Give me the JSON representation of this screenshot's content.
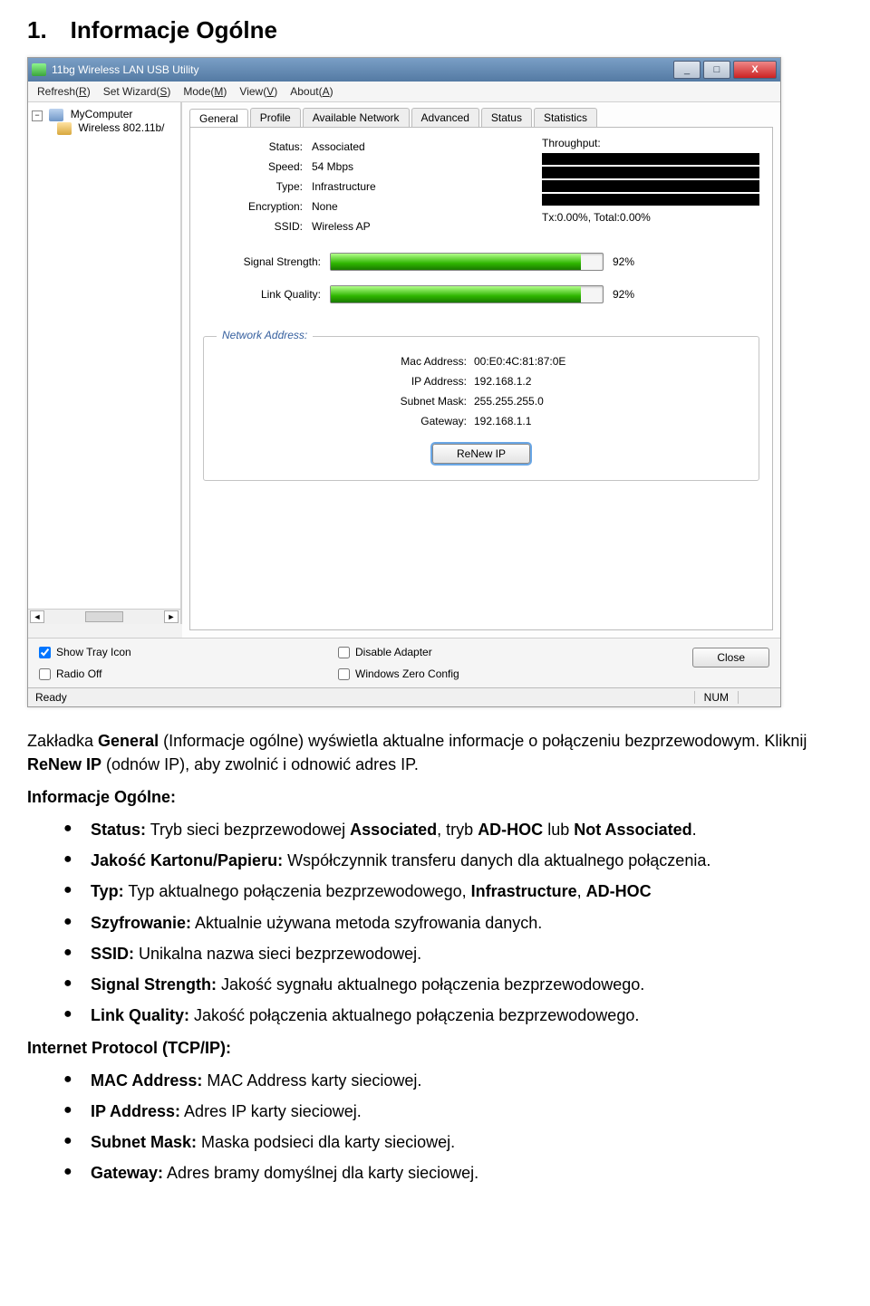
{
  "doc": {
    "heading": "1. Informacje Ogólne",
    "p_intro_1": "Zakładka ",
    "p_intro_b1": "General",
    "p_intro_2": " (Informacje ogólne) wyświetla aktualne informacje o połączeniu bezprzewodowym. Kliknij ",
    "p_intro_b2": "ReNew IP",
    "p_intro_3": " (odnów IP), aby zwolnić i odnowić adres IP.",
    "hdr_general": "Informacje Ogólne:",
    "b_status_k": "Status:",
    "b_status_v1": " Tryb sieci bezprzewodowej ",
    "b_status_b1": "Associated",
    "b_status_v2": ", tryb ",
    "b_status_b2": "AD-HOC",
    "b_status_v3": " lub ",
    "b_status_b3": "Not Associated",
    "b_status_v4": ".",
    "b_quality_k": "Jakość Kartonu/Papieru:",
    "b_quality_v": " Współczynnik transferu danych dla aktualnego połączenia.",
    "b_type_k": "Typ:",
    "b_type_v1": " Typ aktualnego połączenia bezprzewodowego, ",
    "b_type_b1": "Infrastructure",
    "b_type_v2": ", ",
    "b_type_b2": "AD-HOC",
    "b_enc_k": "Szyfrowanie:",
    "b_enc_v": " Aktualnie używana metoda szyfrowania danych.",
    "b_ssid_k": "SSID:",
    "b_ssid_v": " Unikalna nazwa sieci bezprzewodowej.",
    "b_sig_k": "Signal Strength:",
    "b_sig_v": " Jakość sygnału aktualnego połączenia bezprzewodowego.",
    "b_link_k": "Link Quality:",
    "b_link_v": " Jakość połączenia aktualnego połączenia bezprzewodowego.",
    "hdr_tcpip": "Internet Protocol (TCP/IP):",
    "b_mac_k": "MAC Address:",
    "b_mac_v": " MAC Address karty sieciowej.",
    "b_ip_k": "IP Address:",
    "b_ip_v": " Adres IP karty sieciowej.",
    "b_mask_k": "Subnet Mask:",
    "b_mask_v": " Maska podsieci dla karty sieciowej.",
    "b_gw_k": "Gateway:",
    "b_gw_v": " Adres bramy domyślnej dla karty sieciowej."
  },
  "win": {
    "title": "11bg Wireless LAN USB Utility",
    "menu": {
      "refresh_pre": "Refresh(",
      "refresh_u": "R",
      "refresh_post": ")",
      "setwiz_pre": "Set Wizard(",
      "setwiz_u": "S",
      "setwiz_post": ")",
      "mode_pre": "Mode(",
      "mode_u": "M",
      "mode_post": ")",
      "view_pre": "View(",
      "view_u": "V",
      "view_post": ")",
      "about_pre": "About(",
      "about_u": "A",
      "about_post": ")"
    },
    "tree": {
      "node1": "MyComputer",
      "node2": "Wireless 802.11b/",
      "collapse": "−"
    },
    "tabs": [
      "General",
      "Profile",
      "Available Network",
      "Advanced",
      "Status",
      "Statistics"
    ],
    "labels": {
      "status": "Status:",
      "speed": "Speed:",
      "type": "Type:",
      "encryption": "Encryption:",
      "ssid": "SSID:",
      "throughput": "Throughput:",
      "signal": "Signal Strength:",
      "linkq": "Link Quality:",
      "na": "Network Address:",
      "mac": "Mac Address:",
      "ip": "IP Address:",
      "mask": "Subnet Mask:",
      "gw": "Gateway:"
    },
    "values": {
      "status": "Associated",
      "speed": "54 Mbps",
      "type": "Infrastructure",
      "encryption": "None",
      "ssid": "Wireless AP",
      "txline": "Tx:0.00%, Total:0.00%",
      "signal_pct": "92%",
      "linkq_pct": "92%",
      "mac": "00:E0:4C:81:87:0E",
      "ip": "192.168.1.2",
      "mask": "255.255.255.0",
      "gw": "192.168.1.1"
    },
    "buttons": {
      "renew": "ReNew IP",
      "close": "Close"
    },
    "checks": {
      "showtray": "Show Tray Icon",
      "radiooff": "Radio Off",
      "disable": "Disable Adapter",
      "wzc": "Windows Zero Config"
    },
    "status": {
      "ready": "Ready",
      "num": "NUM"
    },
    "winbtn": {
      "min": "_",
      "max": "□",
      "close": "X"
    }
  }
}
